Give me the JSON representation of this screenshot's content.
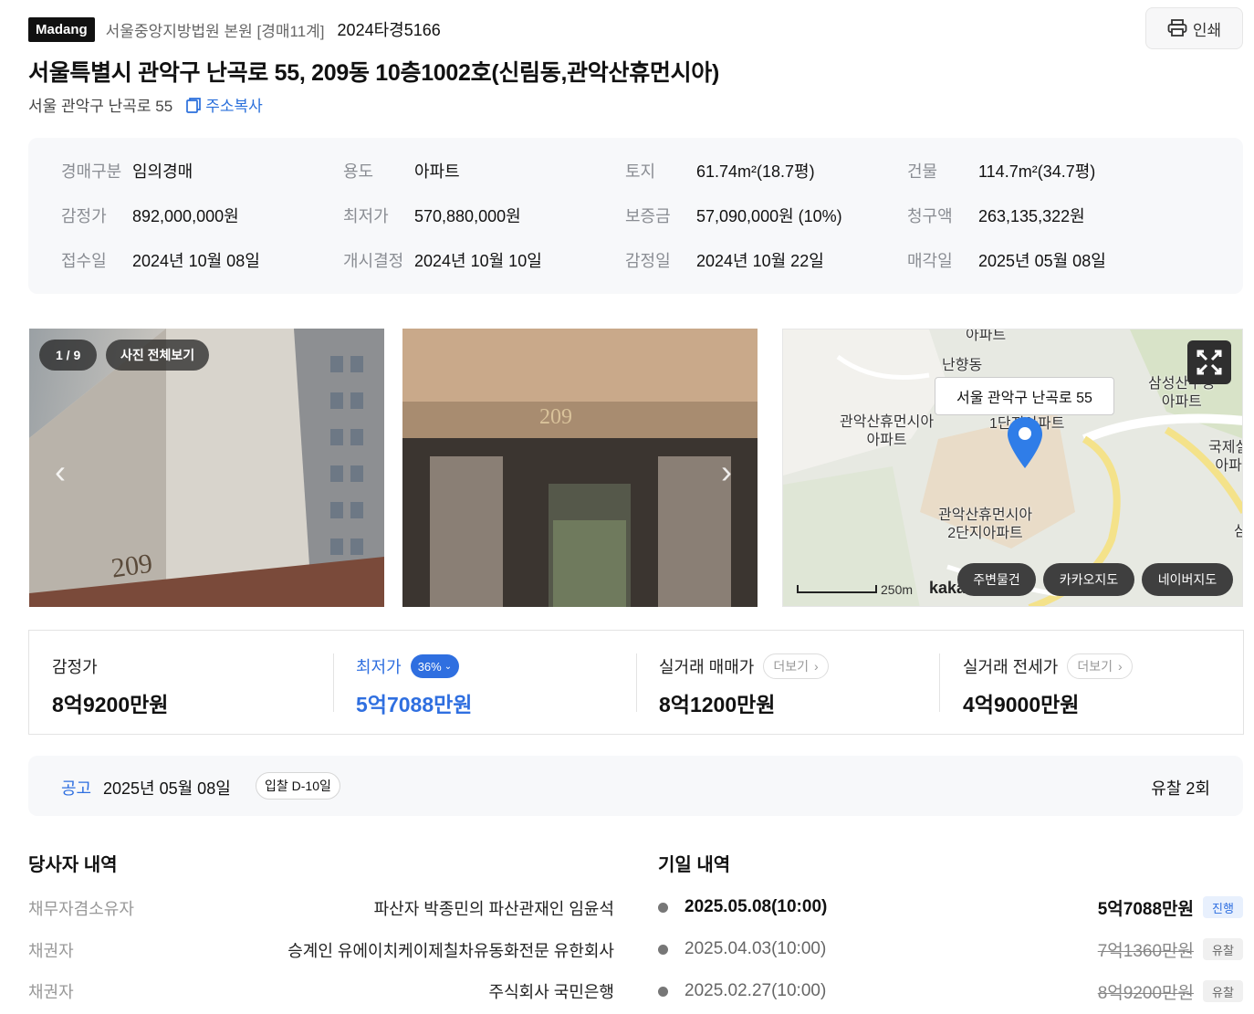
{
  "header": {
    "logo": "Madang",
    "court": "서울중앙지방법원 본원 [경매11계]",
    "case_no": "2024타경5166",
    "print_label": "인쇄"
  },
  "title": "서울특별시 관악구 난곡로 55, 209동 10층1002호(신림동,관악산휴먼시아)",
  "sub_address": "서울 관악구 난곡로 55",
  "copy_label": "주소복사",
  "info": [
    {
      "label": "경매구분",
      "value": "임의경매"
    },
    {
      "label": "용도",
      "value": "아파트"
    },
    {
      "label": "토지",
      "value": "61.74m²(18.7평)"
    },
    {
      "label": "건물",
      "value": "114.7m²(34.7평)"
    },
    {
      "label": "감정가",
      "value": "892,000,000원"
    },
    {
      "label": "최저가",
      "value": "570,880,000원"
    },
    {
      "label": "보증금",
      "value": "57,090,000원 (10%)"
    },
    {
      "label": "청구액",
      "value": "263,135,322원"
    },
    {
      "label": "접수일",
      "value": "2024년 10월 08일"
    },
    {
      "label": "개시결정",
      "value": "2024년 10월 10일"
    },
    {
      "label": "감정일",
      "value": "2024년 10월 22일"
    },
    {
      "label": "매각일",
      "value": "2025년 05월 08일"
    }
  ],
  "photos": {
    "counter": "1 / 9",
    "view_all": "사진 전체보기",
    "building_number": "209"
  },
  "map": {
    "tooltip": "서울 관악구 난곡로 55",
    "labels": [
      "아파트",
      "난향동",
      "관악산휴먼시아\n아파트",
      "1단지아파트",
      "관악산휴먼시아\n2단지아파트",
      "삼성산주공\n아파트",
      "국제실\n아파",
      "삼"
    ],
    "scale": "250m",
    "brand": "kakao",
    "buttons": [
      "주변물건",
      "카카오지도",
      "네이버지도"
    ]
  },
  "prices": {
    "appraisal_label": "감정가",
    "appraisal_value": "8억9200만원",
    "min_label": "최저가",
    "min_badge": "36%",
    "min_value": "5억7088만원",
    "sale_label": "실거래 매매가",
    "sale_value": "8억1200만원",
    "jeonse_label": "실거래 전세가",
    "jeonse_value": "4억9000만원",
    "more_label": "더보기"
  },
  "notice": {
    "label": "공고",
    "date": "2025년 05월 08일",
    "dday": "입찰 D-10일",
    "failed": "유찰 2회"
  },
  "parties": {
    "title": "당사자 내역",
    "rows": [
      {
        "role": "채무자겸소유자",
        "name": "파산자 박종민의 파산관재인 임윤석"
      },
      {
        "role": "채권자",
        "name": "승계인 유에이치케이제칠차유동화전문 유한회사"
      },
      {
        "role": "채권자",
        "name": "주식회사 국민은행"
      }
    ]
  },
  "dates": {
    "title": "기일 내역",
    "rows": [
      {
        "date": "2025.05.08(10:00)",
        "price": "5억7088만원",
        "status": "진행"
      },
      {
        "date": "2025.04.03(10:00)",
        "price": "7억1360만원",
        "status": "유찰"
      },
      {
        "date": "2025.02.27(10:00)",
        "price": "8억9200만원",
        "status": "유찰"
      }
    ]
  },
  "colors": {
    "accent": "#2f6fe0",
    "panel": "#f7f8fa"
  }
}
